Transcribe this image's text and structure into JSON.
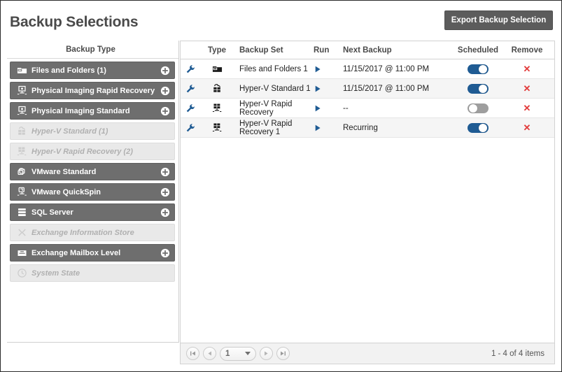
{
  "header": {
    "title": "Backup Selections",
    "export_label": "Export Backup Selection"
  },
  "sidebar": {
    "header": "Backup Type",
    "items": [
      {
        "label": "Files and Folders (1)",
        "icon": "folder-icon",
        "enabled": true
      },
      {
        "label": "Physical Imaging Rapid Recovery",
        "icon": "server-monitor-icon",
        "enabled": true
      },
      {
        "label": "Physical Imaging Standard",
        "icon": "server-monitor-icon",
        "enabled": true
      },
      {
        "label": "Hyper-V Standard (1)",
        "icon": "hyperv-standard-icon",
        "enabled": false
      },
      {
        "label": "Hyper-V Rapid Recovery (2)",
        "icon": "hyperv-rapid-icon",
        "enabled": false
      },
      {
        "label": "VMware Standard",
        "icon": "vmware-standard-icon",
        "enabled": true
      },
      {
        "label": "VMware QuickSpin",
        "icon": "vmware-quickspin-icon",
        "enabled": true
      },
      {
        "label": "SQL Server",
        "icon": "database-icon",
        "enabled": true
      },
      {
        "label": "Exchange Information Store",
        "icon": "exchange-icon",
        "enabled": false
      },
      {
        "label": "Exchange Mailbox Level",
        "icon": "mailbox-icon",
        "enabled": true
      },
      {
        "label": "System State",
        "icon": "clock-icon",
        "enabled": false
      }
    ],
    "add_icon": "plus-circle-icon"
  },
  "grid": {
    "columns": {
      "type": "Type",
      "backup_set": "Backup Set",
      "run": "Run",
      "next_backup": "Next Backup",
      "scheduled": "Scheduled",
      "remove": "Remove"
    },
    "rows": [
      {
        "edit_icon": "wrench-icon",
        "type_icon": "folder-icon",
        "backup_set": "Files and Folders 1",
        "run_icon": "play-icon",
        "next_backup": "11/15/2017 @ 11:00 PM",
        "scheduled": true,
        "remove_icon": "x-icon"
      },
      {
        "edit_icon": "wrench-icon",
        "type_icon": "hyperv-standard-icon",
        "backup_set": "Hyper-V Standard 1",
        "run_icon": "play-icon",
        "next_backup": "11/15/2017 @ 11:00 PM",
        "scheduled": true,
        "remove_icon": "x-icon"
      },
      {
        "edit_icon": "wrench-icon",
        "type_icon": "hyperv-rapid-icon",
        "backup_set": "Hyper-V Rapid Recovery",
        "run_icon": "play-icon",
        "next_backup": "--",
        "scheduled": false,
        "remove_icon": "x-icon"
      },
      {
        "edit_icon": "wrench-icon",
        "type_icon": "hyperv-rapid-icon",
        "backup_set": "Hyper-V Rapid Recovery 1",
        "run_icon": "play-icon",
        "next_backup": "Recurring",
        "scheduled": true,
        "remove_icon": "x-icon"
      }
    ]
  },
  "pager": {
    "first_icon": "first-page-icon",
    "prev_icon": "prev-page-icon",
    "page_value": "1",
    "dropdown_icon": "chevron-down-icon",
    "next_icon": "next-page-icon",
    "last_icon": "last-page-icon",
    "info": "1 - 4 of 4 items"
  },
  "colors": {
    "accent_blue": "#1f5b93",
    "toggle_off": "#9e9e9e",
    "remove_red": "#e23b3b",
    "item_enabled_bg": "#6e6e6e",
    "item_disabled_bg": "#e9e9e9",
    "title_gray": "#4a4a4a"
  }
}
